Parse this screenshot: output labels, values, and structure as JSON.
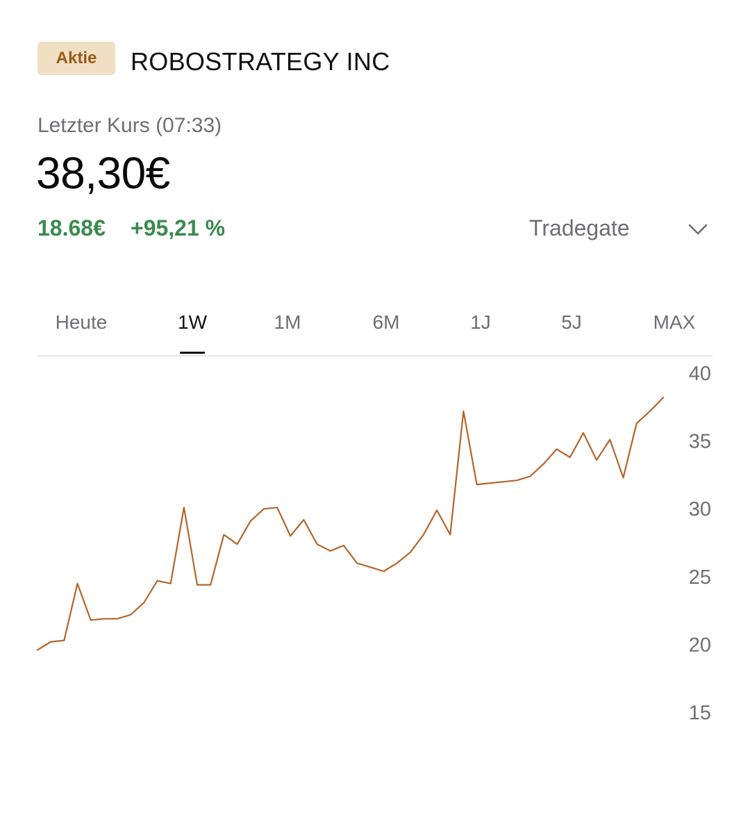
{
  "header": {
    "badge": "Aktie",
    "company": "ROBOSTRATEGY INC"
  },
  "quote": {
    "last_label": "Letzter Kurs (07:33)",
    "price": "38,30€",
    "change_abs": "18.68€",
    "change_pct": "+95,21 %",
    "exchange": "Tradegate",
    "accent_positive": "#3b8a50"
  },
  "tabs": [
    {
      "label": "Heute",
      "active": false
    },
    {
      "label": "1W",
      "active": true
    },
    {
      "label": "1M",
      "active": false
    },
    {
      "label": "6M",
      "active": false
    },
    {
      "label": "1J",
      "active": false
    },
    {
      "label": "5J",
      "active": false
    },
    {
      "label": "MAX",
      "active": false
    }
  ],
  "icons": {
    "exchange_dropdown": "chevron-down-icon"
  },
  "chart_data": {
    "type": "line",
    "color": "#b5652a",
    "yticks": [
      40,
      35,
      30,
      25,
      20,
      15
    ],
    "ylim": [
      15,
      40
    ],
    "grid": false,
    "series": [
      {
        "values": [
          19.6,
          20.2,
          20.3,
          24.5,
          21.8,
          21.9,
          21.9,
          22.2,
          23.1,
          24.7,
          24.5,
          30.1,
          24.4,
          24.4,
          28.1,
          27.4,
          29.1,
          30.0,
          30.1,
          28.0,
          29.2,
          27.4,
          26.9,
          27.3,
          26.0,
          25.7,
          25.4,
          26.0,
          26.8,
          28.1,
          29.9,
          28.1,
          37.2,
          31.8,
          31.9,
          32.0,
          32.1,
          32.4,
          33.3,
          34.4,
          33.8,
          35.6,
          33.6,
          35.1,
          32.3,
          36.3,
          37.2,
          38.2
        ]
      }
    ]
  }
}
